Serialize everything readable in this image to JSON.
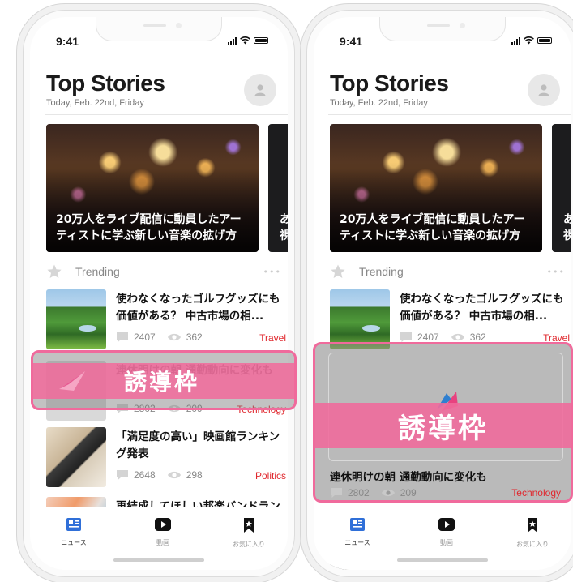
{
  "status_bar": {
    "time": "9:41"
  },
  "header": {
    "title": "Top Stories",
    "subtitle": "Today, Feb. 22nd, Friday"
  },
  "hero": {
    "main_title": "20万人をライブ配信に動員したアーティストに学ぶ新しい音楽の拡げ方",
    "next_title_partial": "あ視"
  },
  "trending": {
    "label": "Trending",
    "more": "•••"
  },
  "articles": [
    {
      "title": "使わなくなったゴルフグッズにも価値がある？ 中古市場の相...",
      "comments": "2407",
      "views": "362",
      "category": "Travel"
    },
    {
      "title": "連休明けの朝 通勤動向に変化も",
      "comments": "2802",
      "views": "209",
      "category": "Technology"
    },
    {
      "title": "「満足度の高い」映画館ランキング発表",
      "comments": "2648",
      "views": "298",
      "category": "Politics"
    },
    {
      "title": "再結成してほしい邦楽バンドランキング"
    }
  ],
  "tabs": [
    {
      "label": "ニュース",
      "icon": "news-icon"
    },
    {
      "label": "動画",
      "icon": "video-play-icon"
    },
    {
      "label": "お気に入り",
      "icon": "bookmark-icon"
    }
  ],
  "overlay": {
    "label": "誘導枠"
  },
  "colors": {
    "accent": "#f06a9c",
    "category_red": "#e0282e",
    "tab_active": "#2f6fd8"
  }
}
